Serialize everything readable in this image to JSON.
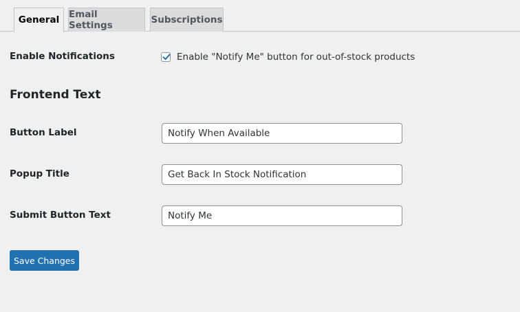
{
  "tabs": [
    {
      "label": "General",
      "active": true
    },
    {
      "label": "Email Settings",
      "active": false
    },
    {
      "label": "Subscriptions",
      "active": false
    }
  ],
  "enable_notifications": {
    "label": "Enable Notifications",
    "checkbox_label": "Enable \"Notify Me\" button for out-of-stock products",
    "checked": true
  },
  "frontend_text": {
    "heading": "Frontend Text",
    "button_label": {
      "label": "Button Label",
      "value": "Notify When Available"
    },
    "popup_title": {
      "label": "Popup Title",
      "value": "Get Back In Stock Notification"
    },
    "submit_button_text": {
      "label": "Submit Button Text",
      "value": "Notify Me"
    }
  },
  "save_button": {
    "label": "Save Changes"
  },
  "colors": {
    "accent": "#2271b1",
    "background": "#f0f0f1"
  },
  "icons": {
    "checkbox_mark": "checkmark-icon"
  }
}
